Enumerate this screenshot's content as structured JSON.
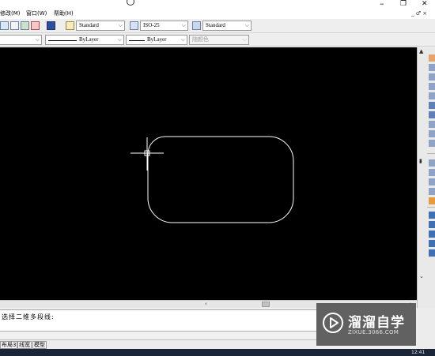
{
  "window": {
    "minimize_glyph": "–",
    "restore_glyph": "❐",
    "close_glyph": "✕"
  },
  "menu": {
    "items": [
      "修改(M)",
      "窗口(W)",
      "帮助(H)"
    ],
    "doc_controls": "_ ♂ ×"
  },
  "styles_toolbar": {
    "text_style": "Standard",
    "dim_style": "ISO-25",
    "table_style": "Standard"
  },
  "properties_toolbar": {
    "linetype": "ByLayer",
    "lineweight": "ByLayer",
    "plot_style": "随颜色"
  },
  "colors": {
    "canvas_bg": "#000000",
    "drawing_stroke": "#ffffff",
    "watermark_bg": "#555555"
  },
  "command": {
    "prompt": "选择二维多段线:"
  },
  "status": {
    "tabs": [
      "布局3",
      "线宽",
      "模型"
    ]
  },
  "watermark": {
    "title": "溜溜自学",
    "url": "ZIXUE.3066.COM"
  },
  "clock": {
    "time": "12:41"
  }
}
